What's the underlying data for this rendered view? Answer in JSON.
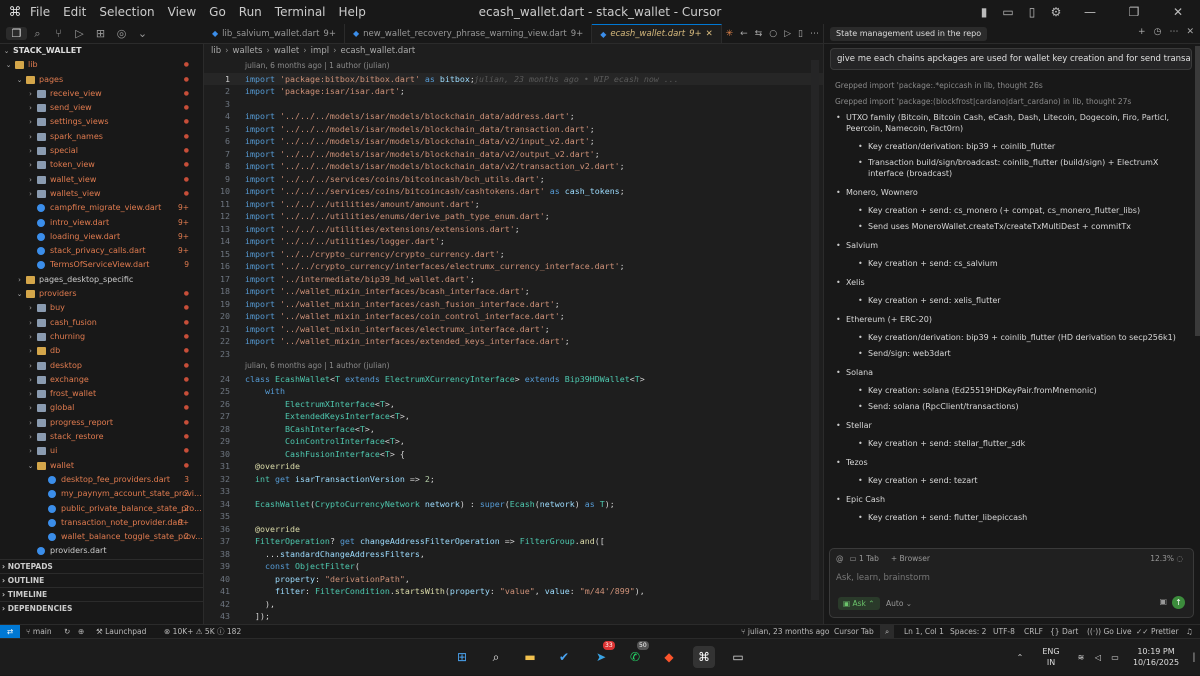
{
  "titlebar": {
    "menu": [
      "File",
      "Edit",
      "Selection",
      "View",
      "Go",
      "Run",
      "Terminal",
      "Help"
    ],
    "title": "ecash_wallet.dart - stack_wallet - Cursor"
  },
  "explorer": {
    "root": "STACK_WALLET",
    "rows": [
      {
        "label": "lib",
        "depth": 0,
        "type": "folder-open",
        "color": "#d4a64a",
        "text_color": "#e07b4f",
        "badge": "",
        "badge_color": "#c74e39",
        "dot": true
      },
      {
        "label": "pages",
        "depth": 1,
        "type": "folder-open",
        "color": "#d4a64a",
        "text_color": "#e07b4f",
        "dot": true
      },
      {
        "label": "receive_view",
        "depth": 2,
        "type": "folder",
        "color": "#8a9bb0",
        "text_color": "#e07b4f",
        "dot": true
      },
      {
        "label": "send_view",
        "depth": 2,
        "type": "folder",
        "color": "#8a9bb0",
        "text_color": "#e07b4f",
        "dot": true
      },
      {
        "label": "settings_views",
        "depth": 2,
        "type": "folder",
        "color": "#8a9bb0",
        "text_color": "#e07b4f",
        "dot": true
      },
      {
        "label": "spark_names",
        "depth": 2,
        "type": "folder",
        "color": "#8a9bb0",
        "text_color": "#e07b4f",
        "dot": true
      },
      {
        "label": "special",
        "depth": 2,
        "type": "folder",
        "color": "#8a9bb0",
        "text_color": "#e07b4f",
        "dot": true
      },
      {
        "label": "token_view",
        "depth": 2,
        "type": "folder",
        "color": "#8a9bb0",
        "text_color": "#e07b4f",
        "dot": true
      },
      {
        "label": "wallet_view",
        "depth": 2,
        "type": "folder",
        "color": "#8a9bb0",
        "text_color": "#e07b4f",
        "dot": true
      },
      {
        "label": "wallets_view",
        "depth": 2,
        "type": "folder",
        "color": "#8a9bb0",
        "text_color": "#e07b4f",
        "dot": true
      },
      {
        "label": "campfire_migrate_view.dart",
        "depth": 2,
        "type": "dart",
        "color": "#3b8eea",
        "text_color": "#e07b4f",
        "badge": "9+"
      },
      {
        "label": "intro_view.dart",
        "depth": 2,
        "type": "dart",
        "color": "#3b8eea",
        "text_color": "#e07b4f",
        "badge": "9+"
      },
      {
        "label": "loading_view.dart",
        "depth": 2,
        "type": "dart",
        "color": "#3b8eea",
        "text_color": "#e07b4f",
        "badge": "9+"
      },
      {
        "label": "stack_privacy_calls.dart",
        "depth": 2,
        "type": "dart",
        "color": "#3b8eea",
        "text_color": "#e07b4f",
        "badge": "9+"
      },
      {
        "label": "TermsOfServiceView.dart",
        "depth": 2,
        "type": "dart",
        "color": "#3b8eea",
        "text_color": "#e07b4f",
        "badge": "9"
      },
      {
        "label": "pages_desktop_specific",
        "depth": 1,
        "type": "folder",
        "color": "#d4a64a",
        "text_color": "#cccccc",
        "dot": false
      },
      {
        "label": "providers",
        "depth": 1,
        "type": "folder-open",
        "color": "#d4a64a",
        "text_color": "#e07b4f",
        "dot": true
      },
      {
        "label": "buy",
        "depth": 2,
        "type": "folder",
        "color": "#8a9bb0",
        "text_color": "#e07b4f",
        "dot": true
      },
      {
        "label": "cash_fusion",
        "depth": 2,
        "type": "folder",
        "color": "#8a9bb0",
        "text_color": "#e07b4f",
        "dot": true
      },
      {
        "label": "churning",
        "depth": 2,
        "type": "folder",
        "color": "#8a9bb0",
        "text_color": "#e07b4f",
        "dot": true
      },
      {
        "label": "db",
        "depth": 2,
        "type": "folder",
        "color": "#d4a64a",
        "text_color": "#e07b4f",
        "dot": true
      },
      {
        "label": "desktop",
        "depth": 2,
        "type": "folder",
        "color": "#8a9bb0",
        "text_color": "#e07b4f",
        "dot": true
      },
      {
        "label": "exchange",
        "depth": 2,
        "type": "folder",
        "color": "#8a9bb0",
        "text_color": "#e07b4f",
        "dot": true
      },
      {
        "label": "frost_wallet",
        "depth": 2,
        "type": "folder",
        "color": "#8a9bb0",
        "text_color": "#e07b4f",
        "dot": true
      },
      {
        "label": "global",
        "depth": 2,
        "type": "folder",
        "color": "#8a9bb0",
        "text_color": "#e07b4f",
        "dot": true
      },
      {
        "label": "progress_report",
        "depth": 2,
        "type": "folder",
        "color": "#8a9bb0",
        "text_color": "#e07b4f",
        "dot": true
      },
      {
        "label": "stack_restore",
        "depth": 2,
        "type": "folder",
        "color": "#8a9bb0",
        "text_color": "#e07b4f",
        "dot": true
      },
      {
        "label": "ui",
        "depth": 2,
        "type": "folder",
        "color": "#8a9bb0",
        "text_color": "#e07b4f",
        "dot": true
      },
      {
        "label": "wallet",
        "depth": 2,
        "type": "folder-open",
        "color": "#d4a64a",
        "text_color": "#e07b4f",
        "dot": true
      },
      {
        "label": "desktop_fee_providers.dart",
        "depth": 3,
        "type": "dart",
        "color": "#3b8eea",
        "text_color": "#e07b4f",
        "badge": "3"
      },
      {
        "label": "my_paynym_account_state_provi...",
        "depth": 3,
        "type": "dart",
        "color": "#3b8eea",
        "text_color": "#e07b4f",
        "badge": "2"
      },
      {
        "label": "public_private_balance_state_pro...",
        "depth": 3,
        "type": "dart",
        "color": "#3b8eea",
        "text_color": "#e07b4f",
        "badge": "2"
      },
      {
        "label": "transaction_note_provider.dart",
        "depth": 3,
        "type": "dart",
        "color": "#3b8eea",
        "text_color": "#e07b4f",
        "badge": "9+"
      },
      {
        "label": "wallet_balance_toggle_state_prov...",
        "depth": 3,
        "type": "dart",
        "color": "#3b8eea",
        "text_color": "#e07b4f",
        "badge": "2"
      },
      {
        "label": "providers.dart",
        "depth": 2,
        "type": "dart",
        "color": "#3b8eea",
        "text_color": "#cccccc",
        "badge": ""
      }
    ],
    "sections": [
      "NOTEPADS",
      "OUTLINE",
      "TIMELINE",
      "DEPENDENCIES"
    ]
  },
  "tabs": [
    {
      "label": "lib_salvium_wallet.dart",
      "badge": "9+",
      "active": false
    },
    {
      "label": "new_wallet_recovery_phrase_warning_view.dart",
      "badge": "9+",
      "active": false
    },
    {
      "label": "ecash_wallet.dart",
      "badge": "9+",
      "active": true
    }
  ],
  "breadcrumb": [
    "lib",
    "wallets",
    "wallet",
    "impl",
    "ecash_wallet.dart"
  ],
  "codelens1": "julian, 6 months ago | 1 author (julian)",
  "codelens2": "julian, 6 months ago | 1 author (julian)",
  "blame_inline": "julian, 23 months ago • WIP ecash now ...",
  "code_lines_1": [
    {
      "n": "1",
      "html": "<span class='k'>import</span> <span class='s'>'package:bitbox/bitbox.dart'</span> <span class='k'>as</span> <span class='v'>bitbox</span>;"
    },
    {
      "n": "2",
      "html": "<span class='k'>import</span> <span class='s'>'package:isar/isar.dart'</span>;"
    },
    {
      "n": "3",
      "html": ""
    },
    {
      "n": "4",
      "html": "<span class='k'>import</span> <span class='s'>'../../../models/isar/models/blockchain_data/address.dart'</span>;"
    },
    {
      "n": "5",
      "html": "<span class='k'>import</span> <span class='s'>'../../../models/isar/models/blockchain_data/transaction.dart'</span>;"
    },
    {
      "n": "6",
      "html": "<span class='k'>import</span> <span class='s'>'../../../models/isar/models/blockchain_data/v2/input_v2.dart'</span>;"
    },
    {
      "n": "7",
      "html": "<span class='k'>import</span> <span class='s'>'../../../models/isar/models/blockchain_data/v2/output_v2.dart'</span>;"
    },
    {
      "n": "8",
      "html": "<span class='k'>import</span> <span class='s'>'../../../models/isar/models/blockchain_data/v2/transaction_v2.dart'</span>;"
    },
    {
      "n": "9",
      "html": "<span class='k'>import</span> <span class='s'>'../../../services/coins/bitcoincash/bch_utils.dart'</span>;"
    },
    {
      "n": "10",
      "html": "<span class='k'>import</span> <span class='s'>'../../../services/coins/bitcoincash/cashtokens.dart'</span> <span class='k'>as</span> <span class='v'>cash_tokens</span>;"
    },
    {
      "n": "11",
      "html": "<span class='k'>import</span> <span class='s'>'../../../utilities/amount/amount.dart'</span>;"
    },
    {
      "n": "12",
      "html": "<span class='k'>import</span> <span class='s'>'../../../utilities/enums/derive_path_type_enum.dart'</span>;"
    },
    {
      "n": "13",
      "html": "<span class='k'>import</span> <span class='s'>'../../../utilities/extensions/extensions.dart'</span>;"
    },
    {
      "n": "14",
      "html": "<span class='k'>import</span> <span class='s'>'../../../utilities/logger.dart'</span>;"
    },
    {
      "n": "15",
      "html": "<span class='k'>import</span> <span class='s'>'../../crypto_currency/crypto_currency.dart'</span>;"
    },
    {
      "n": "16",
      "html": "<span class='k'>import</span> <span class='s'>'../../crypto_currency/interfaces/electrumx_currency_interface.dart'</span>;"
    },
    {
      "n": "17",
      "html": "<span class='k'>import</span> <span class='s'>'../intermediate/bip39_hd_wallet.dart'</span>;"
    },
    {
      "n": "18",
      "html": "<span class='k'>import</span> <span class='s'>'../wallet_mixin_interfaces/bcash_interface.dart'</span>;"
    },
    {
      "n": "19",
      "html": "<span class='k'>import</span> <span class='s'>'../wallet_mixin_interfaces/cash_fusion_interface.dart'</span>;"
    },
    {
      "n": "20",
      "html": "<span class='k'>import</span> <span class='s'>'../wallet_mixin_interfaces/coin_control_interface.dart'</span>;"
    },
    {
      "n": "21",
      "html": "<span class='k'>import</span> <span class='s'>'../wallet_mixin_interfaces/electrumx_interface.dart'</span>;"
    },
    {
      "n": "22",
      "html": "<span class='k'>import</span> <span class='s'>'../wallet_mixin_interfaces/extended_keys_interface.dart'</span>;"
    }
  ],
  "code_lines_2": [
    {
      "n": "24",
      "html": "<span class='k'>class</span> <span class='t'>EcashWallet</span>&lt;<span class='t'>T</span> <span class='k'>extends</span> <span class='t'>ElectrumXCurrencyInterface</span>&gt; <span class='k'>extends</span> <span class='t'>Bip39HDWallet</span>&lt;<span class='t'>T</span>&gt;"
    },
    {
      "n": "25",
      "html": "    <span class='k'>with</span>"
    },
    {
      "n": "26",
      "html": "        <span class='t'>ElectrumXInterface</span>&lt;<span class='t'>T</span>&gt;,"
    },
    {
      "n": "27",
      "html": "        <span class='t'>ExtendedKeysInterface</span>&lt;<span class='t'>T</span>&gt;,"
    },
    {
      "n": "28",
      "html": "        <span class='t'>BCashInterface</span>&lt;<span class='t'>T</span>&gt;,"
    },
    {
      "n": "29",
      "html": "        <span class='t'>CoinControlInterface</span>&lt;<span class='t'>T</span>&gt;,"
    },
    {
      "n": "30",
      "html": "        <span class='t'>CashFusionInterface</span>&lt;<span class='t'>T</span>&gt; {"
    },
    {
      "n": "31",
      "html": "  <span class='a'>@override</span>"
    },
    {
      "n": "32",
      "html": "  <span class='t'>int</span> <span class='k'>get</span> <span class='v'>isarTransactionVersion</span> =&gt; <span class='n'>2</span>;"
    },
    {
      "n": "33",
      "html": ""
    },
    {
      "n": "34",
      "html": "  <span class='t'>EcashWallet</span>(<span class='t'>CryptoCurrencyNetwork</span> <span class='v'>network</span>) : <span class='k'>super</span>(<span class='t'>Ecash</span>(<span class='v'>network</span>) <span class='k'>as</span> <span class='t'>T</span>);"
    },
    {
      "n": "35",
      "html": ""
    },
    {
      "n": "36",
      "html": "  <span class='a'>@override</span>"
    },
    {
      "n": "37",
      "html": "  <span class='t'>FilterOperation</span>? <span class='k'>get</span> <span class='v'>changeAddressFilterOperation</span> =&gt; <span class='t'>FilterGroup</span>.<span class='f'>and</span>(["
    },
    {
      "n": "38",
      "html": "    ...<span class='v'>standardChangeAddressFilters</span>,"
    },
    {
      "n": "39",
      "html": "    <span class='k'>const</span> <span class='t'>ObjectFilter</span>("
    },
    {
      "n": "40",
      "html": "      <span class='v'>property</span>: <span class='s'>\"derivationPath\"</span>,"
    },
    {
      "n": "41",
      "html": "      <span class='v'>filter</span>: <span class='t'>FilterCondition</span>.<span class='f'>startsWith</span>(<span class='v'>property</span>: <span class='s'>\"value\"</span>, <span class='v'>value</span>: <span class='s'>\"m/44'/899\"</span>),"
    },
    {
      "n": "42",
      "html": "    ),"
    },
    {
      "n": "43",
      "html": "  ]);"
    }
  ],
  "chat": {
    "tab_title": "State management used in the repo",
    "query": "give me each chains apckages are used for wallet key creation and for send transaction",
    "grep1_prefix": "Grepped",
    "grep1_text": "import 'package:.*epiccash in lib, thought 26s",
    "grep2_prefix": "Grepped",
    "grep2_text": "import 'package:(blockfrost|cardano|dart_cardano) in lib, thought 27s",
    "chains": [
      {
        "name": "UTXO family (Bitcoin, Bitcoin Cash, eCash, Dash, Litecoin, Dogecoin, Firo, Particl, Peercoin, Namecoin, Fact0rn)",
        "details": [
          "Key creation/derivation: bip39 + coinlib_flutter",
          "Transaction build/sign/broadcast: coinlib_flutter (build/sign) + ElectrumX interface (broadcast)"
        ]
      },
      {
        "name": "Monero, Wownero",
        "details": [
          "Key creation + send: cs_monero (+ compat, cs_monero_flutter_libs)",
          "Send uses MoneroWallet.createTx/createTxMultiDest + commitTx"
        ]
      },
      {
        "name": "Salvium",
        "details": [
          "Key creation + send: cs_salvium"
        ]
      },
      {
        "name": "Xelis",
        "details": [
          "Key creation + send: xelis_flutter"
        ]
      },
      {
        "name": "Ethereum (+ ERC-20)",
        "details": [
          "Key creation/derivation: bip39 + coinlib_flutter (HD derivation to secp256k1)",
          "Send/sign: web3dart"
        ]
      },
      {
        "name": "Solana",
        "details": [
          "Key creation: solana (Ed25519HDKeyPair.fromMnemonic)",
          "Send: solana (RpcClient/transactions)"
        ]
      },
      {
        "name": "Stellar",
        "details": [
          "Key creation + send: stellar_flutter_sdk"
        ]
      },
      {
        "name": "Tezos",
        "details": [
          "Key creation + send: tezart"
        ]
      },
      {
        "name": "Epic Cash",
        "details": [
          "Key creation + send: flutter_libepiccash"
        ]
      }
    ],
    "composer": {
      "tabs_chip": "1 Tab",
      "browser_chip": "Browser",
      "context_pct": "12.3%",
      "placeholder": "Ask, learn, brainstorm",
      "mode": "Ask",
      "model": "Auto"
    }
  },
  "statusbar": {
    "branch": "main",
    "launchpad": "Launchpad",
    "stats1": "10K+",
    "stats2": "5K",
    "stats3": "182",
    "blame": "julian, 23 months ago",
    "cursor_tab": "Cursor Tab",
    "position": "Ln 1, Col 1",
    "spaces": "Spaces: 2",
    "encoding": "UTF-8",
    "eol": "CRLF",
    "language": "Dart",
    "golive": "Go Live",
    "prettier": "Prettier"
  },
  "taskbar": {
    "lang1": "ENG",
    "lang2": "IN",
    "time": "10:19 PM",
    "date": "10/16/2025",
    "badge_telegram": "33",
    "badge_whatsapp": "50"
  }
}
